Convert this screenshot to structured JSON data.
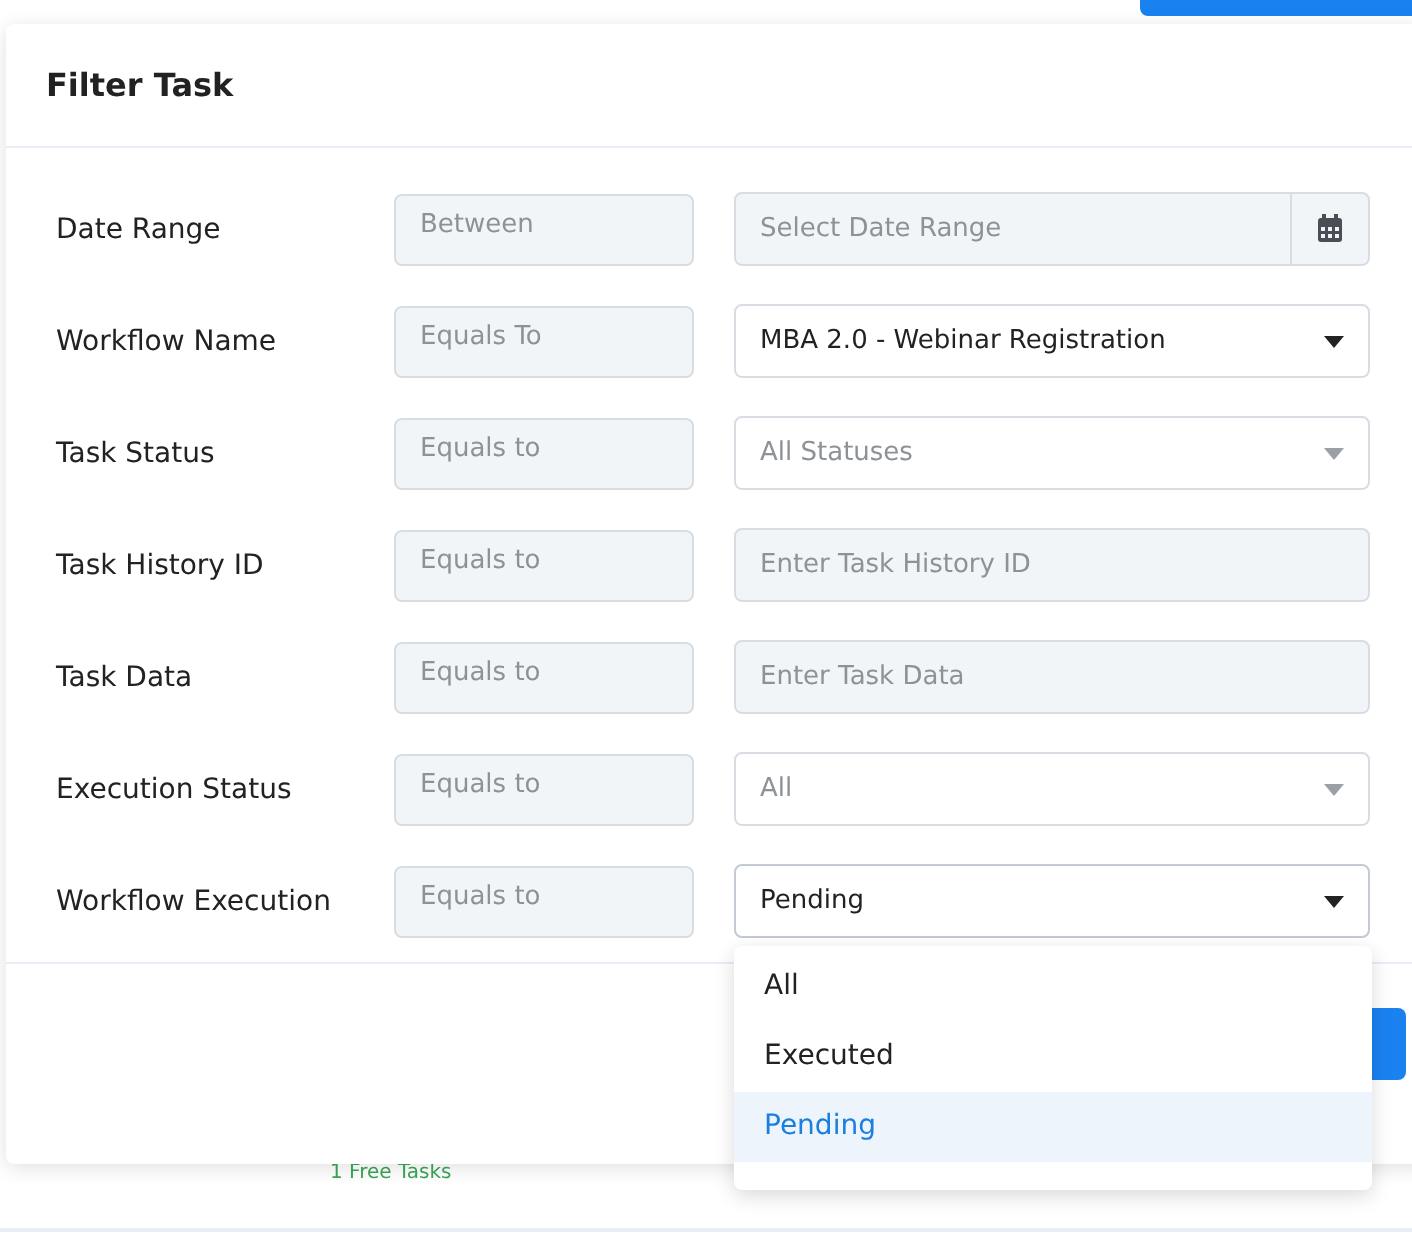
{
  "background": {
    "free_tasks": "1 Free Tasks"
  },
  "modal": {
    "title": "Filter Task",
    "filters": [
      {
        "label": "Date Range",
        "operator": "Between",
        "kind": "date",
        "placeholder": "Select Date Range"
      },
      {
        "label": "Workflow Name",
        "operator": "Equals To",
        "kind": "select",
        "value": "MBA 2.0 - Webinar Registration"
      },
      {
        "label": "Task Status",
        "operator": "Equals to",
        "kind": "select",
        "placeholder": "All Statuses"
      },
      {
        "label": "Task History ID",
        "operator": "Equals to",
        "kind": "text",
        "placeholder": "Enter Task History ID"
      },
      {
        "label": "Task Data",
        "operator": "Equals to",
        "kind": "text",
        "placeholder": "Enter Task Data"
      },
      {
        "label": "Execution Status",
        "operator": "Equals to",
        "kind": "select",
        "placeholder": "All"
      },
      {
        "label": "Workflow Execution",
        "operator": "Equals to",
        "kind": "select",
        "value": "Pending",
        "expanded": true,
        "options": [
          {
            "label": "All",
            "selected": false
          },
          {
            "label": "Executed",
            "selected": false
          },
          {
            "label": "Pending",
            "selected": true
          }
        ]
      }
    ]
  }
}
